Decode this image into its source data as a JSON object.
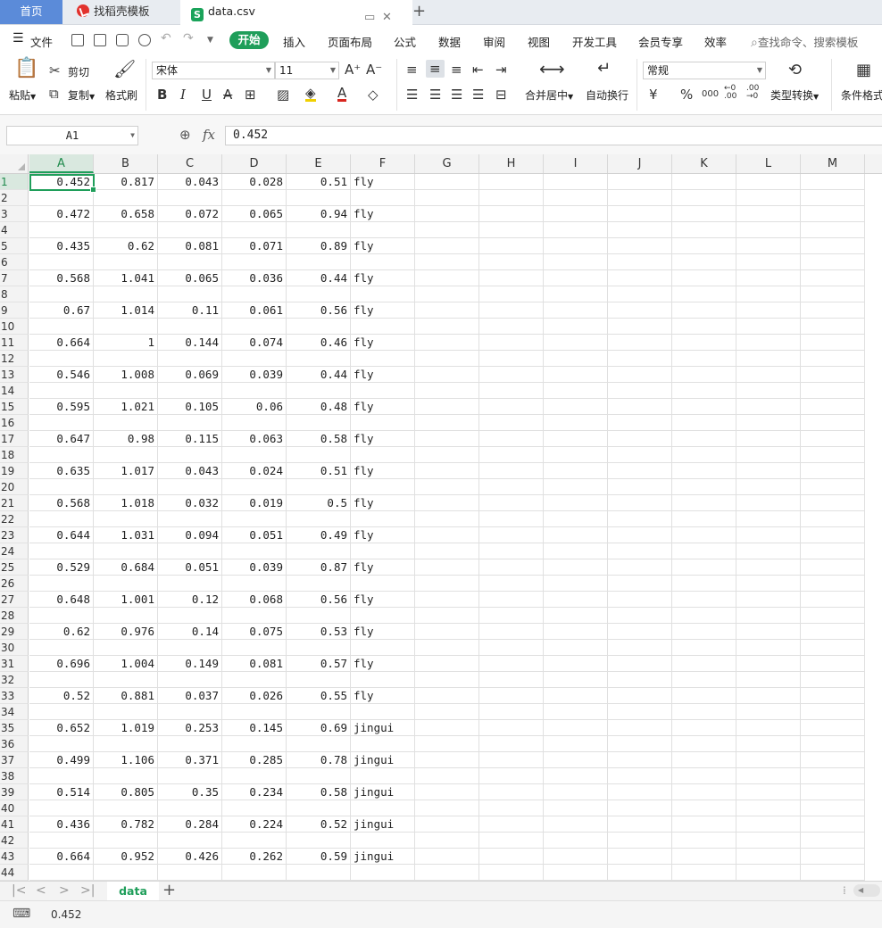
{
  "tabs": {
    "home": "首页",
    "templates": "找稻壳模板",
    "file": "data.csv"
  },
  "menu": {
    "file": "文件",
    "items": [
      "开始",
      "插入",
      "页面布局",
      "公式",
      "数据",
      "审阅",
      "视图",
      "开发工具",
      "会员专享",
      "效率"
    ],
    "search_placeholder": "查找命令、搜索模板"
  },
  "ribbon": {
    "paste": "粘贴",
    "cut": "剪切",
    "copy": "复制",
    "format_painter": "格式刷",
    "font_name": "宋体",
    "font_size": "11",
    "merge_center": "合并居中",
    "wrap_text": "自动换行",
    "number_format": "常规",
    "type_convert": "类型转换",
    "conditional_format": "条件格式"
  },
  "formula": {
    "name_box": "A1",
    "fx": "fx",
    "value": "0.452"
  },
  "columns": [
    "A",
    "B",
    "C",
    "D",
    "E",
    "F",
    "G",
    "H",
    "I",
    "J",
    "K",
    "L",
    "M"
  ],
  "rows": [
    {
      "n": "1",
      "a": "0.452",
      "b": "0.817",
      "c": "0.043",
      "d": "0.028",
      "e": "0.51",
      "f": "fly"
    },
    {
      "n": "2"
    },
    {
      "n": "3",
      "a": "0.472",
      "b": "0.658",
      "c": "0.072",
      "d": "0.065",
      "e": "0.94",
      "f": "fly"
    },
    {
      "n": "4"
    },
    {
      "n": "5",
      "a": "0.435",
      "b": "0.62",
      "c": "0.081",
      "d": "0.071",
      "e": "0.89",
      "f": "fly"
    },
    {
      "n": "6"
    },
    {
      "n": "7",
      "a": "0.568",
      "b": "1.041",
      "c": "0.065",
      "d": "0.036",
      "e": "0.44",
      "f": "fly"
    },
    {
      "n": "8"
    },
    {
      "n": "9",
      "a": "0.67",
      "b": "1.014",
      "c": "0.11",
      "d": "0.061",
      "e": "0.56",
      "f": "fly"
    },
    {
      "n": "10"
    },
    {
      "n": "11",
      "a": "0.664",
      "b": "1",
      "c": "0.144",
      "d": "0.074",
      "e": "0.46",
      "f": "fly"
    },
    {
      "n": "12"
    },
    {
      "n": "13",
      "a": "0.546",
      "b": "1.008",
      "c": "0.069",
      "d": "0.039",
      "e": "0.44",
      "f": "fly"
    },
    {
      "n": "14"
    },
    {
      "n": "15",
      "a": "0.595",
      "b": "1.021",
      "c": "0.105",
      "d": "0.06",
      "e": "0.48",
      "f": "fly"
    },
    {
      "n": "16"
    },
    {
      "n": "17",
      "a": "0.647",
      "b": "0.98",
      "c": "0.115",
      "d": "0.063",
      "e": "0.58",
      "f": "fly"
    },
    {
      "n": "18"
    },
    {
      "n": "19",
      "a": "0.635",
      "b": "1.017",
      "c": "0.043",
      "d": "0.024",
      "e": "0.51",
      "f": "fly"
    },
    {
      "n": "20"
    },
    {
      "n": "21",
      "a": "0.568",
      "b": "1.018",
      "c": "0.032",
      "d": "0.019",
      "e": "0.5",
      "f": "fly"
    },
    {
      "n": "22"
    },
    {
      "n": "23",
      "a": "0.644",
      "b": "1.031",
      "c": "0.094",
      "d": "0.051",
      "e": "0.49",
      "f": "fly"
    },
    {
      "n": "24"
    },
    {
      "n": "25",
      "a": "0.529",
      "b": "0.684",
      "c": "0.051",
      "d": "0.039",
      "e": "0.87",
      "f": "fly"
    },
    {
      "n": "26"
    },
    {
      "n": "27",
      "a": "0.648",
      "b": "1.001",
      "c": "0.12",
      "d": "0.068",
      "e": "0.56",
      "f": "fly"
    },
    {
      "n": "28"
    },
    {
      "n": "29",
      "a": "0.62",
      "b": "0.976",
      "c": "0.14",
      "d": "0.075",
      "e": "0.53",
      "f": "fly"
    },
    {
      "n": "30"
    },
    {
      "n": "31",
      "a": "0.696",
      "b": "1.004",
      "c": "0.149",
      "d": "0.081",
      "e": "0.57",
      "f": "fly"
    },
    {
      "n": "32"
    },
    {
      "n": "33",
      "a": "0.52",
      "b": "0.881",
      "c": "0.037",
      "d": "0.026",
      "e": "0.55",
      "f": "fly"
    },
    {
      "n": "34"
    },
    {
      "n": "35",
      "a": "0.652",
      "b": "1.019",
      "c": "0.253",
      "d": "0.145",
      "e": "0.69",
      "f": "jingui"
    },
    {
      "n": "36"
    },
    {
      "n": "37",
      "a": "0.499",
      "b": "1.106",
      "c": "0.371",
      "d": "0.285",
      "e": "0.78",
      "f": "jingui"
    },
    {
      "n": "38"
    },
    {
      "n": "39",
      "a": "0.514",
      "b": "0.805",
      "c": "0.35",
      "d": "0.234",
      "e": "0.58",
      "f": "jingui"
    },
    {
      "n": "40"
    },
    {
      "n": "41",
      "a": "0.436",
      "b": "0.782",
      "c": "0.284",
      "d": "0.224",
      "e": "0.52",
      "f": "jingui"
    },
    {
      "n": "42"
    },
    {
      "n": "43",
      "a": "0.664",
      "b": "0.952",
      "c": "0.426",
      "d": "0.262",
      "e": "0.59",
      "f": "jingui"
    },
    {
      "n": "44"
    }
  ],
  "sheet": {
    "name": "data"
  },
  "status": {
    "value": "0.452"
  },
  "colors": {
    "accent": "#1f9e5a",
    "home_tab": "#5b8bd9",
    "stamp_red": "#e2322d"
  }
}
